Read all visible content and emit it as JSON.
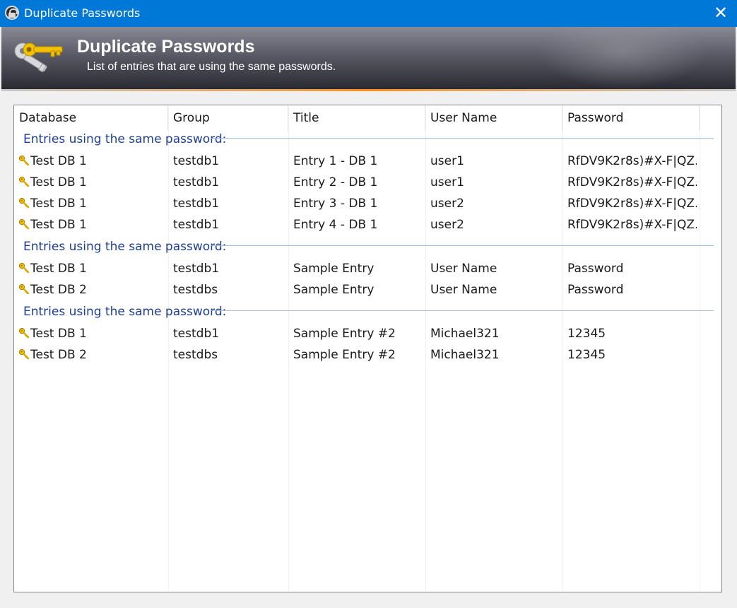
{
  "window": {
    "title": "Duplicate Passwords",
    "close_symbol": "✕"
  },
  "banner": {
    "heading": "Duplicate Passwords",
    "subheading": "List of entries that are using the same passwords.",
    "icon": "keys-icon"
  },
  "columns": [
    "Database",
    "Group",
    "Title",
    "User Name",
    "Password"
  ],
  "groups": [
    {
      "label": "Entries using the same password:",
      "rows": [
        {
          "icon": "key-icon",
          "database": "Test DB 1",
          "group": "testdb1",
          "title": "Entry 1 - DB 1",
          "username": "user1",
          "password": "RfDV9K2r8s)#X-F|QZ..."
        },
        {
          "icon": "key-icon",
          "database": "Test DB 1",
          "group": "testdb1",
          "title": "Entry 2 - DB 1",
          "username": "user1",
          "password": "RfDV9K2r8s)#X-F|QZ..."
        },
        {
          "icon": "key-icon",
          "database": "Test DB 1",
          "group": "testdb1",
          "title": "Entry 3 - DB 1",
          "username": "user2",
          "password": "RfDV9K2r8s)#X-F|QZ..."
        },
        {
          "icon": "key-icon",
          "database": "Test DB 1",
          "group": "testdb1",
          "title": "Entry 4 - DB 1",
          "username": "user2",
          "password": "RfDV9K2r8s)#X-F|QZ..."
        }
      ]
    },
    {
      "label": "Entries using the same password:",
      "rows": [
        {
          "icon": "key-icon",
          "database": "Test DB 1",
          "group": "testdb1",
          "title": "Sample Entry",
          "username": "User Name",
          "password": "Password"
        },
        {
          "icon": "key-icon",
          "database": "Test DB 2",
          "group": "testdbs",
          "title": "Sample Entry",
          "username": "User Name",
          "password": "Password"
        }
      ]
    },
    {
      "label": "Entries using the same password:",
      "rows": [
        {
          "icon": "key-icon",
          "database": "Test DB 1",
          "group": "testdb1",
          "title": "Sample Entry #2",
          "username": "Michael321",
          "password": "12345"
        },
        {
          "icon": "key-icon",
          "database": "Test DB 2",
          "group": "testdbs",
          "title": "Sample Entry #2",
          "username": "Michael321",
          "password": "12345"
        }
      ]
    }
  ],
  "colors": {
    "titlebar": "#0078d7",
    "group_label": "#1e3e92",
    "accent_underline": "#ff8c1a"
  }
}
